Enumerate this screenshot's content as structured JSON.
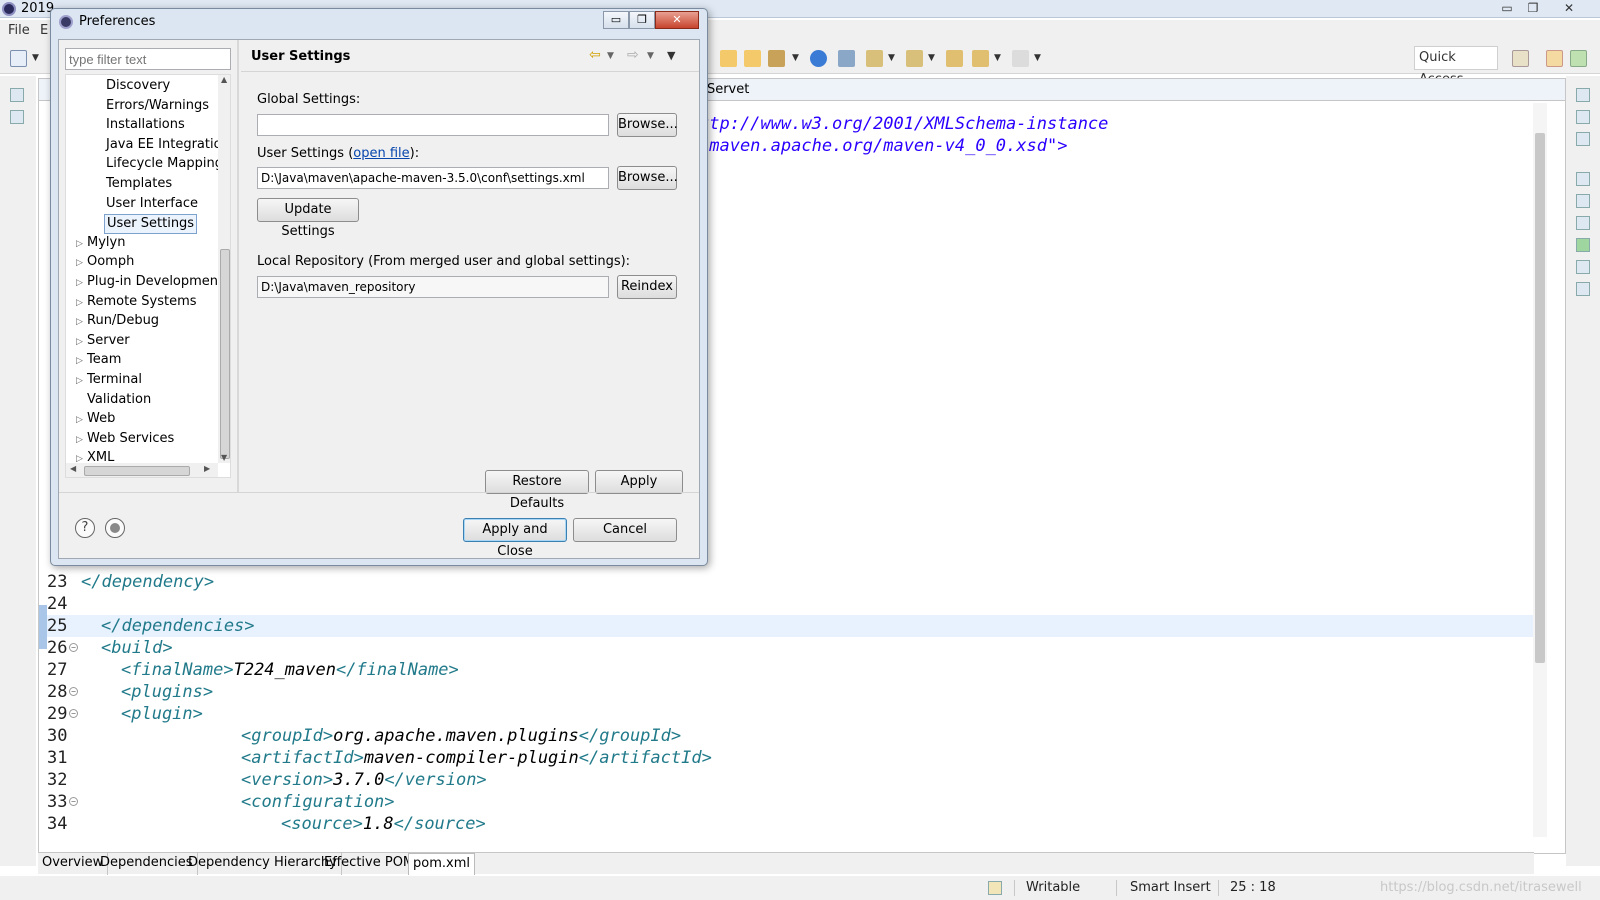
{
  "window": {
    "title": "2019",
    "minimize": "▭",
    "restore": "❐",
    "close": "✕"
  },
  "menu": {
    "file": "File",
    "edit": "E"
  },
  "quick_access": "Quick Access",
  "editor": {
    "tab_label": "oServet",
    "code_lines": [
      {
        "num": "23",
        "indent": 0,
        "parts": [
          {
            "t": "tag",
            "v": "</dependency>"
          }
        ]
      },
      {
        "num": "24",
        "indent": 0,
        "parts": []
      },
      {
        "num": "25",
        "indent": 1,
        "parts": [
          {
            "t": "tag",
            "v": "</dependencies>"
          }
        ],
        "highlight": true
      },
      {
        "num": "26",
        "indent": 1,
        "parts": [
          {
            "t": "tag",
            "v": "<build>"
          }
        ],
        "fold": true
      },
      {
        "num": "27",
        "indent": 2,
        "parts": [
          {
            "t": "tag",
            "v": "<finalName>"
          },
          {
            "t": "txt",
            "v": "T224_maven"
          },
          {
            "t": "tag",
            "v": "</finalName>"
          }
        ]
      },
      {
        "num": "28",
        "indent": 2,
        "parts": [
          {
            "t": "tag",
            "v": "<plugins>"
          }
        ],
        "fold": true
      },
      {
        "num": "29",
        "indent": 2,
        "parts": [
          {
            "t": "tag",
            "v": "<plugin>"
          }
        ],
        "fold": true
      },
      {
        "num": "30",
        "indent": 8,
        "parts": [
          {
            "t": "tag",
            "v": "<groupId>"
          },
          {
            "t": "txt",
            "v": "org.apache.maven.plugins"
          },
          {
            "t": "tag",
            "v": "</groupId>"
          }
        ]
      },
      {
        "num": "31",
        "indent": 8,
        "parts": [
          {
            "t": "tag",
            "v": "<artifactId>"
          },
          {
            "t": "txt",
            "v": "maven-compiler-plugin"
          },
          {
            "t": "tag",
            "v": "</artifactId>"
          }
        ]
      },
      {
        "num": "32",
        "indent": 8,
        "parts": [
          {
            "t": "tag",
            "v": "<version>"
          },
          {
            "t": "txt",
            "v": "3.7.0"
          },
          {
            "t": "tag",
            "v": "</version>"
          }
        ]
      },
      {
        "num": "33",
        "indent": 8,
        "parts": [
          {
            "t": "tag",
            "v": "<configuration>"
          }
        ],
        "fold": true
      },
      {
        "num": "34",
        "indent": 10,
        "parts": [
          {
            "t": "tag",
            "v": "<source>"
          },
          {
            "t": "txt",
            "v": "1.8"
          },
          {
            "t": "tag",
            "v": "</source>"
          }
        ]
      }
    ],
    "url_line_1": "ttp://www.w3.org/2001/XMLSchema-instance",
    "url_line_2": "/maven.apache.org/maven-v4_0_0.xsd\">"
  },
  "bottom_tabs": [
    "Overview",
    "Dependencies",
    "Dependency Hierarchy",
    "Effective POM",
    "pom.xml"
  ],
  "status": {
    "writable": "Writable",
    "insert_mode": "Smart Insert",
    "position": "25 : 18",
    "watermark": "https://blog.csdn.net/itrasewell"
  },
  "dialog": {
    "title": "Preferences",
    "filter_placeholder": "type filter text",
    "tree": [
      {
        "label": "Discovery",
        "level": 1
      },
      {
        "label": "Errors/Warnings",
        "level": 1
      },
      {
        "label": "Installations",
        "level": 1
      },
      {
        "label": "Java EE Integration",
        "level": 1
      },
      {
        "label": "Lifecycle Mappings",
        "level": 1
      },
      {
        "label": "Templates",
        "level": 1
      },
      {
        "label": "User Interface",
        "level": 1
      },
      {
        "label": "User Settings",
        "level": 1,
        "selected": true
      },
      {
        "label": "Mylyn",
        "level": 0,
        "expandable": true
      },
      {
        "label": "Oomph",
        "level": 0,
        "expandable": true
      },
      {
        "label": "Plug-in Development",
        "level": 0,
        "expandable": true
      },
      {
        "label": "Remote Systems",
        "level": 0,
        "expandable": true
      },
      {
        "label": "Run/Debug",
        "level": 0,
        "expandable": true
      },
      {
        "label": "Server",
        "level": 0,
        "expandable": true
      },
      {
        "label": "Team",
        "level": 0,
        "expandable": true
      },
      {
        "label": "Terminal",
        "level": 0,
        "expandable": true
      },
      {
        "label": "Validation",
        "level": 0,
        "expandable": false
      },
      {
        "label": "Web",
        "level": 0,
        "expandable": true
      },
      {
        "label": "Web Services",
        "level": 0,
        "expandable": true
      },
      {
        "label": "XML",
        "level": 0,
        "expandable": true
      }
    ],
    "page": {
      "title": "User Settings",
      "global_label": "Global Settings:",
      "global_value": "",
      "user_label_prefix": "User Settings (",
      "user_label_link": "open file",
      "user_label_suffix": "):",
      "user_value": "D:\\Java\\maven\\apache-maven-3.5.0\\conf\\settings.xml",
      "browse": "Browse...",
      "update_settings": "Update Settings",
      "local_repo_label": "Local Repository (From merged user and global settings):",
      "local_repo_value": "D:\\Java\\maven_repository",
      "reindex": "Reindex",
      "restore_defaults": "Restore Defaults",
      "apply": "Apply"
    },
    "apply_and_close": "Apply and Close",
    "cancel": "Cancel",
    "help_icon_glyph": "?"
  }
}
